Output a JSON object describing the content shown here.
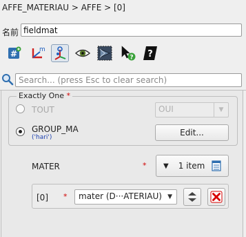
{
  "breadcrumb": "AFFE_MATERIAU > AFFE > [0]",
  "name": {
    "label": "名前",
    "value": "fieldmat"
  },
  "toolbar": {
    "icons": [
      "add-parameter-icon",
      "show-axes-icon",
      "select-active-icon",
      "eye-icon",
      "view-3d-icon",
      "cursor-help-icon",
      "docs-icon"
    ]
  },
  "search": {
    "placeholder": "Search... (press Esc to clear search)",
    "value": ""
  },
  "exactly_one": {
    "title": "Exactly One",
    "required_mark": "*",
    "tout": {
      "label": "TOUT",
      "selected_value": "OUI",
      "disabled": true,
      "checked": false
    },
    "group_ma": {
      "label": "GROUP_MA",
      "value": "('hari')",
      "checked": true,
      "edit_label": "Edit..."
    }
  },
  "mater": {
    "label": "MATER",
    "required_mark": "*",
    "count_label": "1 item",
    "entries": [
      {
        "index": "[0]",
        "required_mark": "*",
        "value": "mater (D···ATERIAU)"
      }
    ]
  },
  "colors": {
    "required": "#d00000",
    "link_value": "#1a3fb0",
    "remove": "#d80000"
  }
}
